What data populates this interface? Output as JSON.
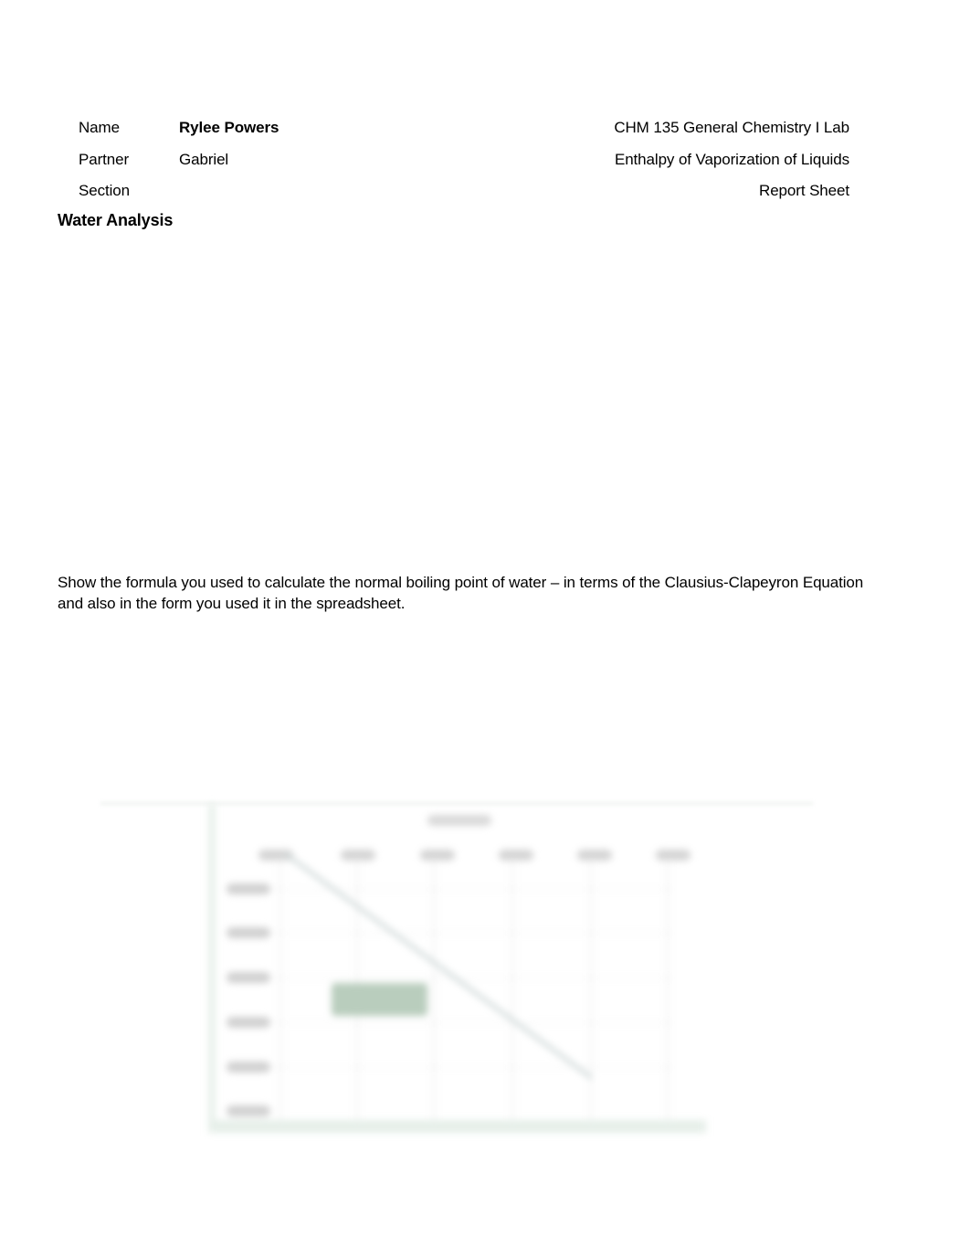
{
  "header": {
    "name_label": "Name",
    "name_value": "Rylee Powers",
    "partner_label": "Partner",
    "partner_value": "Gabriel",
    "section_label": "Section",
    "section_value": "",
    "course": "CHM 135 General Chemistry I Lab",
    "experiment": "Enthalpy of Vaporization of Liquids",
    "sheet_type": "Report Sheet"
  },
  "section_heading": "Water Analysis",
  "prompt": "Show the formula you used to calculate the normal boiling point of water – in terms of the Clausius-Clapeyron Equation and also in the form you used it in the spreadsheet.",
  "chart_preview": {
    "state": "blurred",
    "series_color": "#b9cdbd",
    "border_color": "#e6efe9"
  }
}
